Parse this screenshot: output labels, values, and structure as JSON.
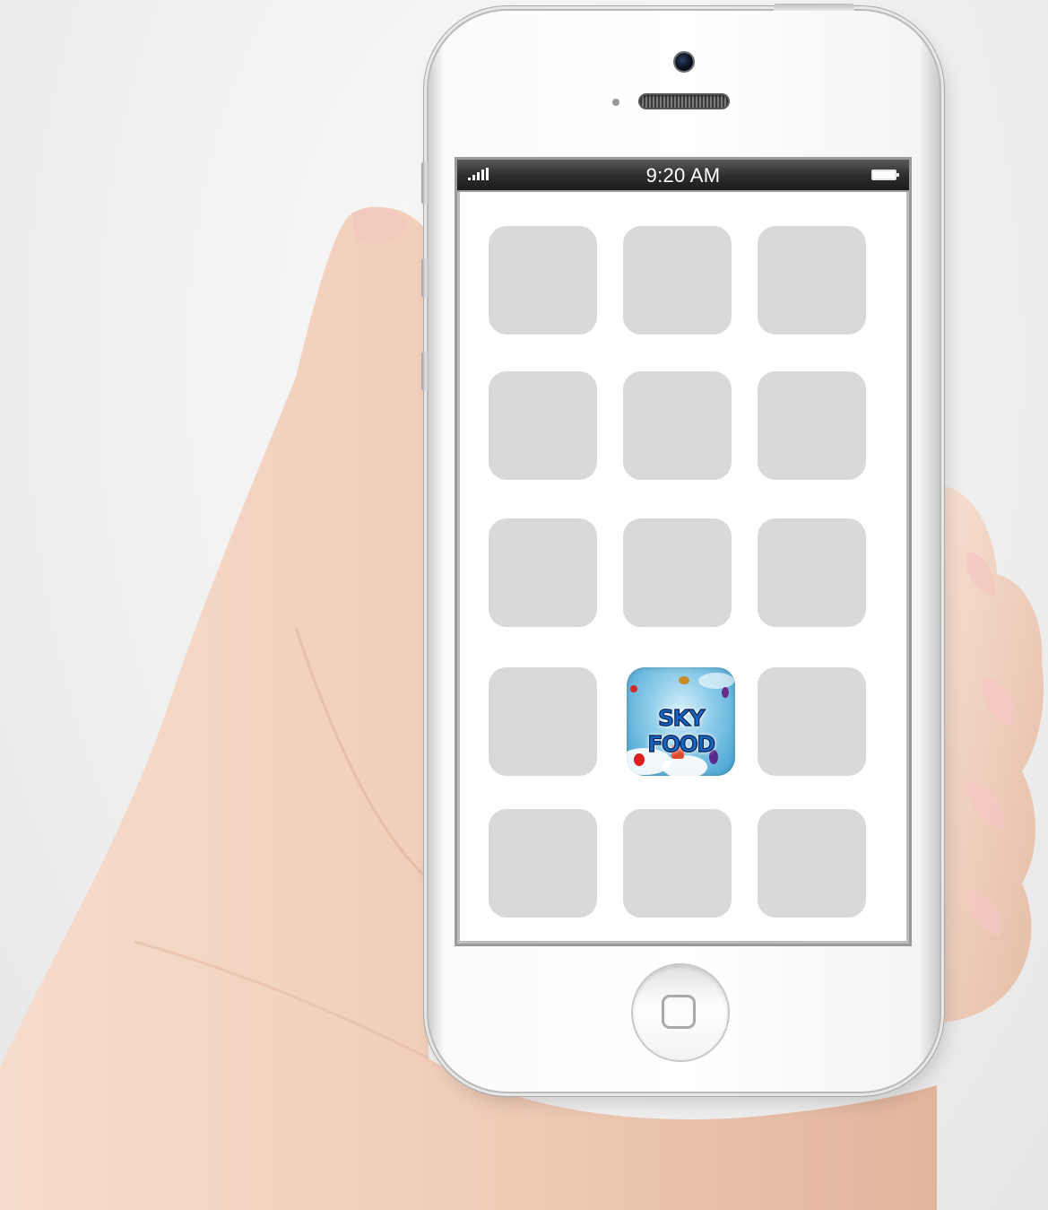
{
  "status_bar": {
    "time": "9:20 AM",
    "signal_icon": "signal-bars-icon",
    "battery_icon": "battery-icon"
  },
  "home_screen": {
    "rows": 5,
    "columns": 3,
    "featured_app": {
      "name": "SKY FOOD",
      "row": 4,
      "column": 2,
      "icon": "sky-food-app-icon"
    },
    "placeholder_color": "#d9d9d9"
  },
  "device": {
    "home_button_icon": "home-button-square-icon",
    "body_color": "#ffffff"
  }
}
